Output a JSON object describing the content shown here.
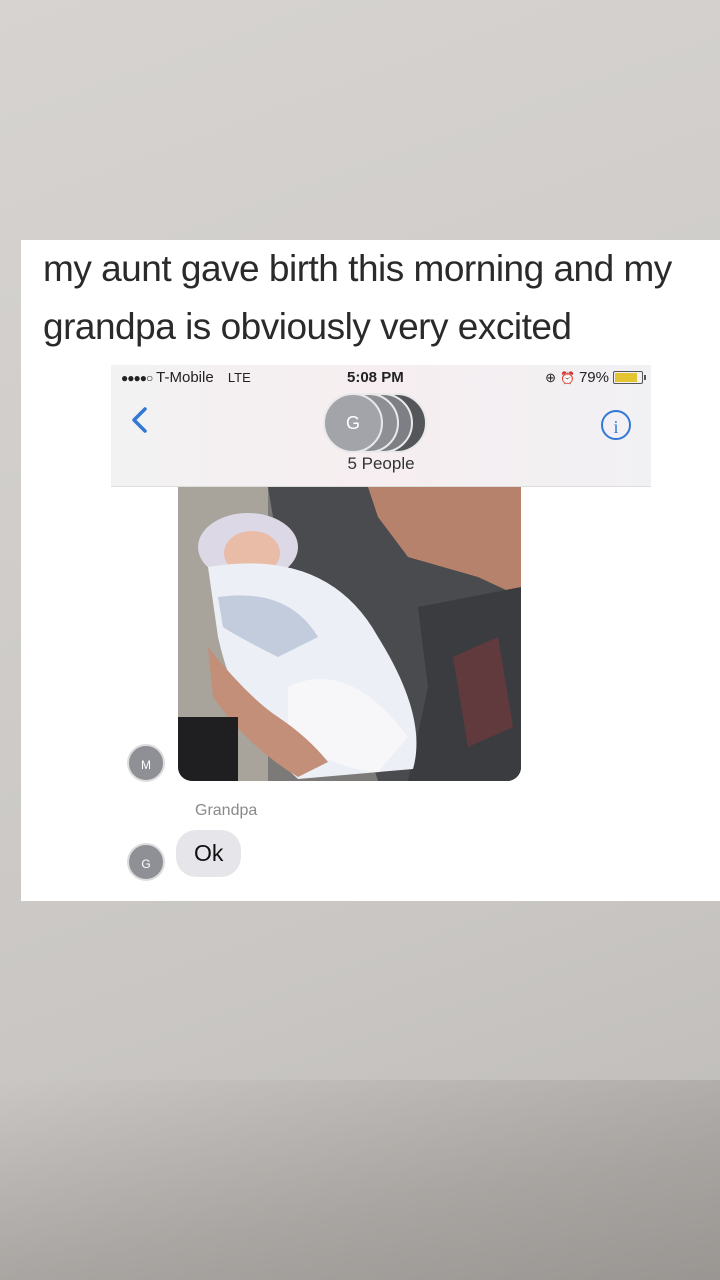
{
  "caption": {
    "line1": "my aunt gave birth this morning and my",
    "line2": "grandpa is obviously very excited"
  },
  "status_bar": {
    "carrier": "T-Mobile",
    "network": "LTE",
    "time": "5:08 PM",
    "battery": "79%",
    "battery_level": 0.79
  },
  "conversation": {
    "group_avatar_initial": "G",
    "participants_label": "5 People",
    "photo_sender_initial": "M",
    "sender_name": "Grandpa",
    "reply_sender_initial": "G",
    "reply_text": "Ok"
  },
  "icons": {
    "back": "chevron-left-icon",
    "info": "info-icon"
  },
  "colors": {
    "ios_blue": "#3478d6",
    "bubble_gray": "#e6e6ea",
    "battery_yellow": "#e3c531"
  }
}
